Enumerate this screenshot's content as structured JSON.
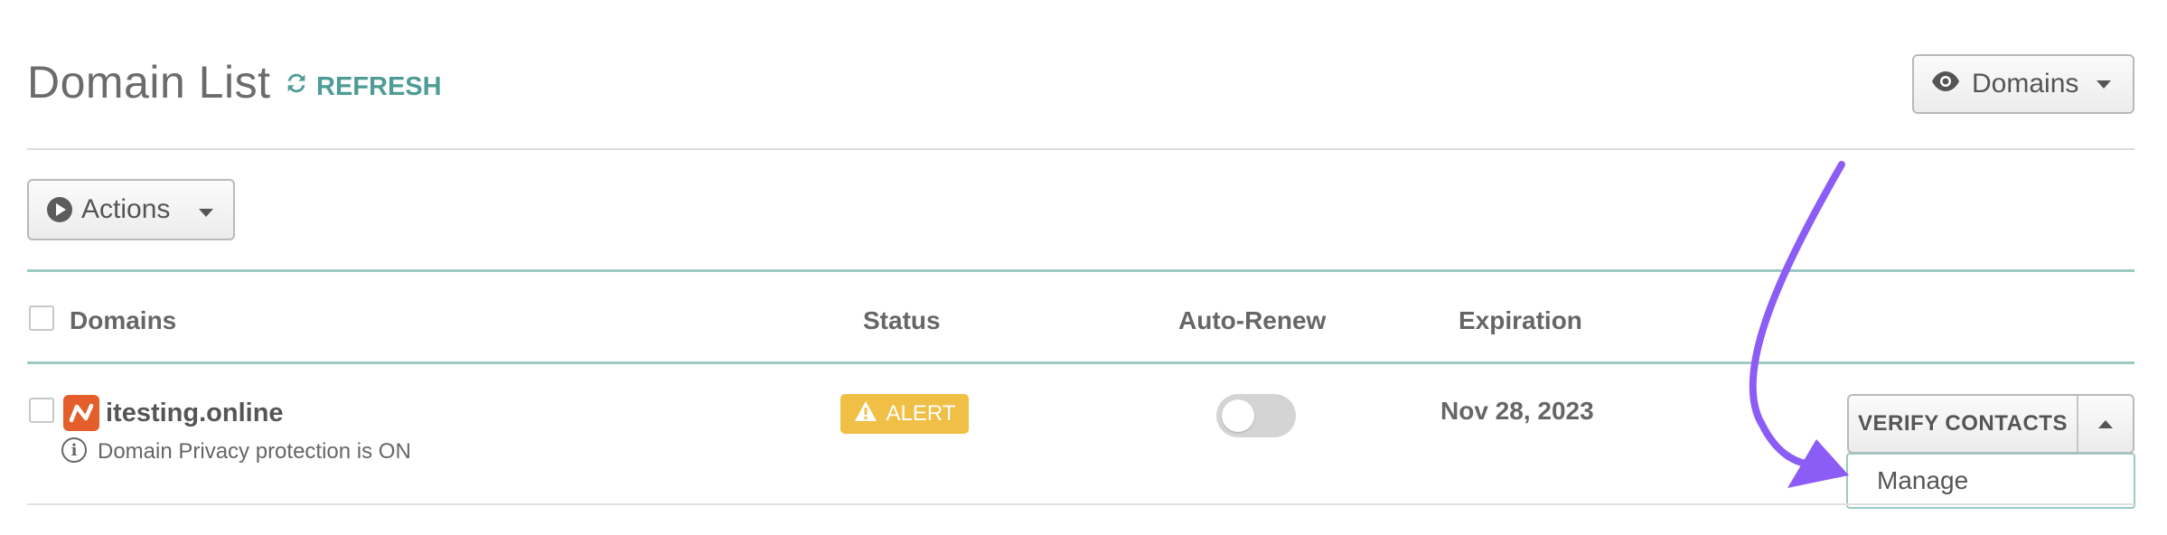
{
  "header": {
    "title": "Domain List",
    "refresh_label": "REFRESH",
    "view_dropdown_label": "Domains"
  },
  "toolbar": {
    "actions_label": "Actions"
  },
  "table": {
    "columns": [
      "Domains",
      "Status",
      "Auto-Renew",
      "Expiration"
    ],
    "rows": [
      {
        "domain": "itesting.online",
        "privacy_note": "Domain Privacy protection is ON",
        "status": "ALERT",
        "auto_renew": false,
        "expiration": "Nov 28, 2023",
        "action_label": "VERIFY CONTACTS",
        "menu_items": [
          "Manage"
        ]
      }
    ]
  },
  "colors": {
    "accent_teal": "#4e9c95",
    "alert_yellow": "#f0bf45",
    "logo_orange": "#e45e2b",
    "annotation_arrow": "#8b5cf6"
  },
  "icons": {
    "refresh": "refresh-icon",
    "view": "eye-icon",
    "actions": "play-circle-icon",
    "status": "warning-icon",
    "info": "info-icon"
  }
}
